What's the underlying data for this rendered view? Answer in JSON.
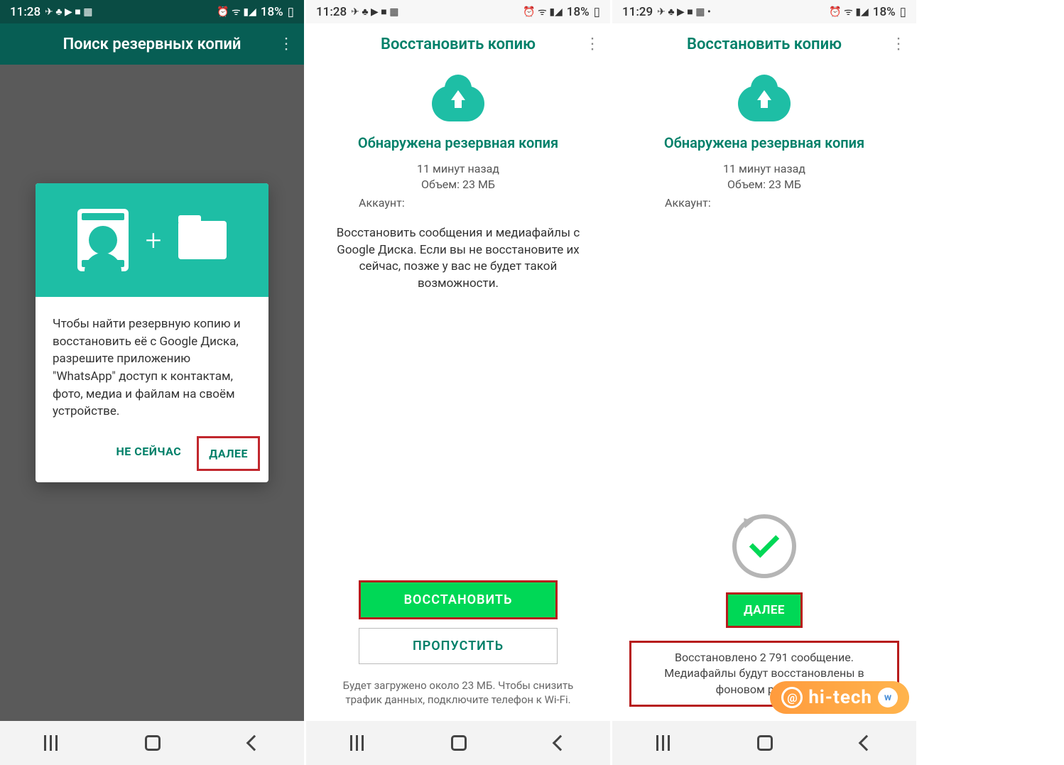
{
  "statusbar": {
    "time1": "11:28",
    "time2": "11:28",
    "time3": "11:29",
    "battery": "18%"
  },
  "screen1": {
    "title": "Поиск резервных копий",
    "modal_text": "Чтобы найти резервную копию и восстановить её с Google Диска, разрешите приложению \"WhatsApp\" доступ к контактам, фото, медиа и файлам на своём устройстве.",
    "not_now": "НЕ СЕЙЧАС",
    "next": "ДАЛЕЕ"
  },
  "screen2": {
    "title": "Восстановить копию",
    "found": "Обнаружена резервная копия",
    "time_ago": "11 минут назад",
    "size": "Объем: 23 МБ",
    "account": "Аккаунт:",
    "desc": "Восстановить сообщения и медиафайлы с Google Диска. Если вы не восстановите их сейчас, позже у вас не будет такой возможности.",
    "restore": "ВОССТАНОВИТЬ",
    "skip": "ПРОПУСТИТЬ",
    "footnote": "Будет загружено около 23 МБ. Чтобы снизить трафик данных, подключите телефон к Wi-Fi."
  },
  "screen3": {
    "title": "Восстановить копию",
    "found": "Обнаружена резервная копия",
    "time_ago": "11 минут назад",
    "size": "Объем: 23 МБ",
    "account": "Аккаунт:",
    "next": "ДАЛЕЕ",
    "restored": "Восстановлено 2 791 сообщение. Медиафайлы будут восстановлены в фоновом режиме."
  },
  "watermark": "hi-tech"
}
